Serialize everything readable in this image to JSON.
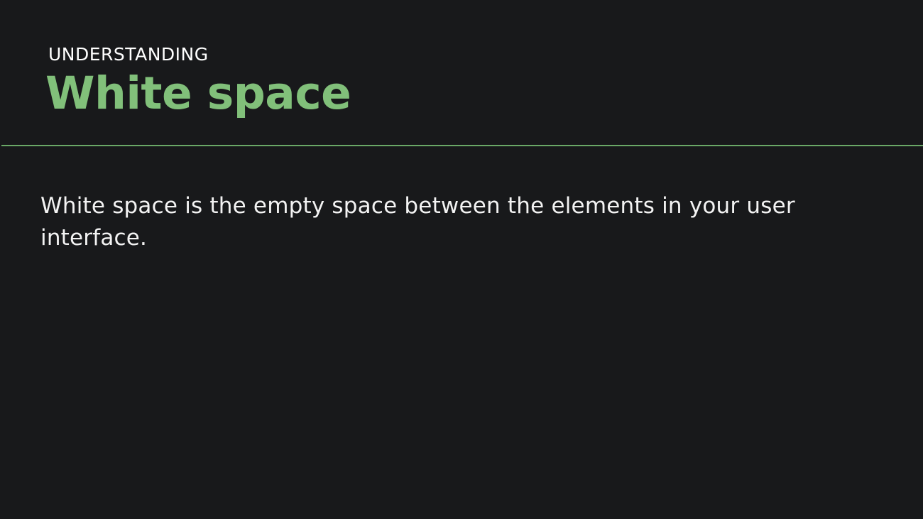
{
  "header": {
    "cropped_strip": "— — — —— — —— — ——— ——— —— — —— —— —— ——— —— ———",
    "eyebrow": "UNDERSTANDING",
    "title": "White space"
  },
  "content": {
    "paragraph": "White space is the empty space between the elements in your user interface."
  },
  "colors": {
    "background": "#18191b",
    "accent": "#81c07a",
    "divider": "#6aa867",
    "text": "#f3f3f3"
  }
}
